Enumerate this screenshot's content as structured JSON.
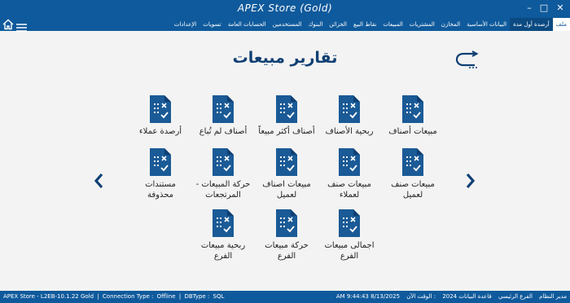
{
  "window": {
    "title": "APEX Store (Gold)",
    "minimize_glyph": "–",
    "maximize_glyph": "□",
    "close_glyph": "✕"
  },
  "menu": {
    "items": [
      {
        "label": "ملف",
        "state": "active"
      },
      {
        "label": "أرصدة أول مدة",
        "state": "sel"
      },
      {
        "label": "البيانات الأساسية",
        "state": ""
      },
      {
        "label": "المخازن",
        "state": ""
      },
      {
        "label": "المشتريات",
        "state": ""
      },
      {
        "label": "المبيعات",
        "state": ""
      },
      {
        "label": "نقاط البيع",
        "state": ""
      },
      {
        "label": "الخزائن",
        "state": ""
      },
      {
        "label": "البنوك",
        "state": ""
      },
      {
        "label": "المستخدمين",
        "state": ""
      },
      {
        "label": "الحسابات العامة",
        "state": ""
      },
      {
        "label": "تسويات",
        "state": ""
      },
      {
        "label": "الإعدادات",
        "state": ""
      }
    ]
  },
  "page": {
    "title": "تقارير مبيعات"
  },
  "icons": {
    "home": "home-icon",
    "menu": "hamburger-icon",
    "back": "back-arrow-icon",
    "report": "report-document-icon",
    "prev": "chevron-left-icon",
    "next": "chevron-right-icon"
  },
  "colors": {
    "brand": "#0f5a9c",
    "title": "#0f3f73",
    "tile_icon": "#1a5a96"
  },
  "tiles": {
    "r1c1": "مبيعات أصناف",
    "r1c2": "ربحية الأصناف",
    "r1c3": "أصناف أكثر مبيعاً",
    "r1c4": "أصناف لم تُباع",
    "r1c5": "أرصدة عملاء",
    "r2c1": "مبيعات صنف لعميل",
    "r2c2": "مبيعات صنف لعملاء",
    "r2c3": "مبيعات اصناف لعميل",
    "r2c4": "حركة المبيعات - المرتجعات",
    "r2c5": "مستندات محذوفة",
    "r3c2": "اجمالى مبيعات الفرع",
    "r3c3": "حركة مبيعات الفرع",
    "r3c4": "ربحية مبيعات الفرع"
  },
  "status": {
    "app": "APEX Store - L2EB-10.1.22 Gold",
    "separator": "|",
    "conn_label": "Connection Type :",
    "conn_value": "Offline",
    "db_label": "DBType :",
    "db_value": "SQL",
    "datetime": "8/13/2025 9:44:43 AM",
    "time_label": ": الوقت الآن",
    "db_name": "قاعدة البيانات 2024",
    "branch": "الفرع الرئيسي",
    "user": "مدير النظام"
  }
}
